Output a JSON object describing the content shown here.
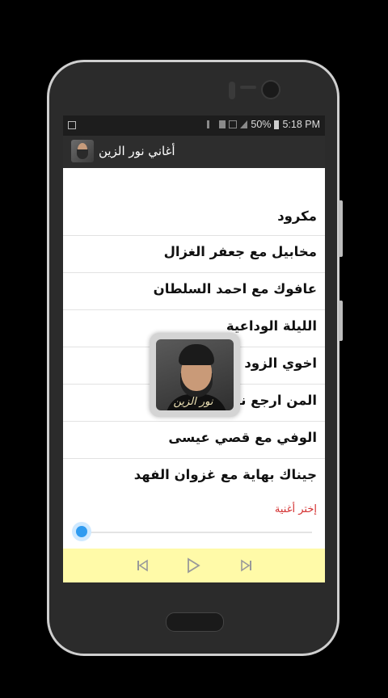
{
  "statusbar": {
    "battery": "50%",
    "time": "5:18 PM"
  },
  "appbar": {
    "title": "أغاني نور الزين"
  },
  "songs": [
    "مكرود",
    "مخابيل  مع جعفر الغزال",
    "عافوك  مع احمد السلطان",
    "الليلة الوداعية",
    "اخوي الزود",
    "المن ارجع  نور الزين",
    "الوفي  مع قصي عيسى",
    "جيناك بهاية  مع غزوان الفهد"
  ],
  "overlay": {
    "caption": "نور الزين"
  },
  "player": {
    "choose_label": "إختر أغنية",
    "progress": 0,
    "icons": [
      "previous-icon",
      "play-icon",
      "next-icon"
    ]
  },
  "colors": {
    "accent": "#2f9bf0",
    "player_bg": "#fffaa8",
    "choose": "#d32f2f",
    "appbar": "#2d2d2d"
  }
}
